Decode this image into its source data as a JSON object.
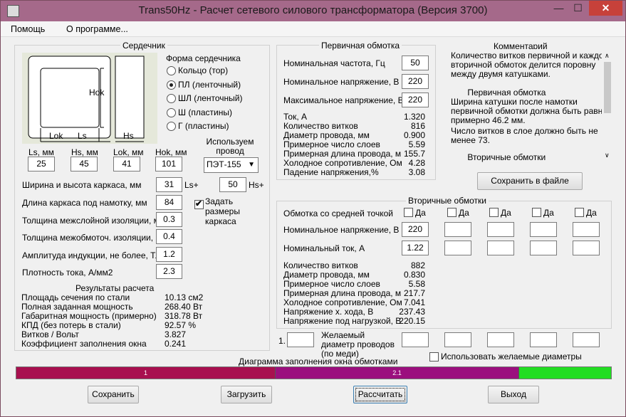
{
  "window": {
    "title": "Trans50Hz - Расчет сетевого силового трансформатора (Версия 3700)",
    "min": "—",
    "max": "☐",
    "close": "✕"
  },
  "menu": [
    "Помощь",
    "О программе..."
  ],
  "core": {
    "title": "Сердечник",
    "diagram": {
      "hok": "Hok",
      "lok": "Lok",
      "ls": "Ls",
      "hs": "Hs"
    },
    "shape_title": "Форма сердечника",
    "shapes": [
      {
        "label": "Кольцо  (тор)",
        "selected": false
      },
      {
        "label": "ПЛ  (ленточный)",
        "selected": true
      },
      {
        "label": "ШЛ  (ленточный)",
        "selected": false
      },
      {
        "label": "Ш  (пластины)",
        "selected": false
      },
      {
        "label": "Г  (пластины)",
        "selected": false
      }
    ],
    "wire_title": "Используем провод",
    "wire_value": "ПЭТ-155",
    "dims": [
      {
        "label": "Ls, мм",
        "value": "25"
      },
      {
        "label": "Hs, мм",
        "value": "45"
      },
      {
        "label": "Lok, мм",
        "value": "41"
      },
      {
        "label": "Hok, мм",
        "value": "101"
      }
    ],
    "params": [
      {
        "label": "Ширина и высота каркаса, мм",
        "value": "31"
      },
      {
        "label": "Длина каркаса под намотку, мм",
        "value": "84"
      },
      {
        "label": "Толщина межслойной изоляции, мм",
        "value": "0.3"
      },
      {
        "label": "Толщина межобмоточ. изоляции, мм",
        "value": "0.4"
      },
      {
        "label": "Амплитуда индукции, не более, Тл",
        "value": "1.2"
      },
      {
        "label": "Плотность тока, А/мм2",
        "value": "2.3"
      }
    ],
    "ls_plus": "Ls+",
    "hs_value": "50",
    "hs_plus": "Hs+",
    "frame_check": {
      "label": "Задать размеры каркаса",
      "checked": true
    },
    "results_title": "Результаты расчета",
    "results": [
      {
        "label": "Площадь сечения по стали",
        "value": "10.13 см2"
      },
      {
        "label": "Полная заданная мощность",
        "value": "268.40 Вт"
      },
      {
        "label": "Габаритная мощность (примерно)",
        "value": "318.78 Вт"
      },
      {
        "label": "КПД (без потерь в стали)",
        "value": "92.57 %"
      },
      {
        "label": "Витков / Вольт",
        "value": "3.827"
      },
      {
        "label": "Коэффициент заполнения окна",
        "value": "0.241"
      }
    ]
  },
  "primary": {
    "title": "Первичная обмотка",
    "inputs": [
      {
        "label": "Номинальная частота, Гц",
        "value": "50"
      },
      {
        "label": "Номинальное напряжение, В",
        "value": "220"
      },
      {
        "label": "Максимальное напряжение, В",
        "value": "220"
      }
    ],
    "results": [
      {
        "label": "Ток, А",
        "value": "1.320"
      },
      {
        "label": "Количество витков",
        "value": "816"
      },
      {
        "label": "Диаметр провода, мм",
        "value": "0.900"
      },
      {
        "label": "Примерное число слоев",
        "value": "5.59"
      },
      {
        "label": "Примерная длина провода, м",
        "value": "155.7"
      },
      {
        "label": "Холодное сопротивление, Ом",
        "value": "4.28"
      },
      {
        "label": "Падение напряжения,%",
        "value": "3.08"
      }
    ]
  },
  "comment": {
    "title": "Комментарий",
    "lines": [
      "Количество витков первичной и каждой",
      "вторичной обмоток делится поровну",
      "между двумя катушками.",
      "",
      "       Первичная обмотка",
      "Ширина катушки после намотки",
      "первичной обмотки должна быть равна",
      "примерно 46.2 мм.",
      "Число витков в слое должно быть не",
      "менее 73.",
      "",
      "       Вторичные обмотки"
    ],
    "save_file": "Сохранить в файле"
  },
  "secondary": {
    "title": "Вторичные обмотки",
    "center_tap": "Обмотка со средней точкой",
    "yes": "Да",
    "voltage_label": "Номинальное напряжение, В",
    "current_label": "Номинальный ток, А",
    "voltage": [
      "220",
      "",
      "",
      "",
      "",
      ""
    ],
    "current": [
      "1.22",
      "",
      "",
      "",
      "",
      ""
    ],
    "results": [
      {
        "label": "Количество витков",
        "value": "882"
      },
      {
        "label": "Диаметр провода, мм",
        "value": "0.830"
      },
      {
        "label": "Примерное число слоев",
        "value": "5.58"
      },
      {
        "label": "Примерная длина провода, м",
        "value": "217.7"
      },
      {
        "label": "Холодное сопротивление, Ом",
        "value": "7.041"
      },
      {
        "label": "Напряжение х. хода, В",
        "value": "237.43"
      },
      {
        "label": "Напряжение под нагрузкой, В",
        "value": "220.15"
      }
    ],
    "desired_num": "1.",
    "desired_label": "Желаемый диаметр проводов  (по меди)",
    "use_desired": "Использовать желаемые диаметры"
  },
  "fill": {
    "title": "Диаграмма заполнения окна обмотками",
    "segments": [
      {
        "label": "1",
        "color": "#a8104f"
      },
      {
        "label": "2.1",
        "color": "#9b0f7e"
      },
      {
        "label": "",
        "color": "#22dd22"
      }
    ]
  },
  "buttons": {
    "save": "Сохранить",
    "load": "Загрузить",
    "calc": "Рассчитать",
    "exit": "Выход"
  }
}
